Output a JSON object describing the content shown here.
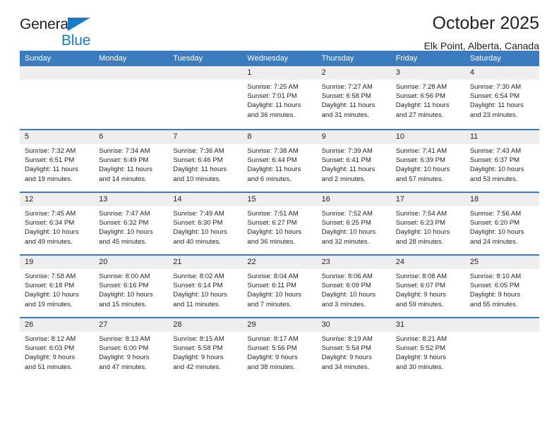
{
  "brand": {
    "name_top": "General",
    "name_bottom": "Blue",
    "triangle_icon": "blue-triangle-logo-icon",
    "accent_color": "#1a7ac4"
  },
  "header": {
    "title": "October 2025",
    "subtitle": "Elk Point, Alberta, Canada"
  },
  "theme": {
    "header_blue": "#3b7cbe",
    "day_band_gray": "#eeeeee",
    "text_color": "#231f20"
  },
  "weekdays": [
    "Sunday",
    "Monday",
    "Tuesday",
    "Wednesday",
    "Thursday",
    "Friday",
    "Saturday"
  ],
  "labels": {
    "sunrise": "Sunrise:",
    "sunset": "Sunset:",
    "daylight": "Daylight:"
  },
  "weeks": [
    [
      {
        "day": "",
        "empty": true
      },
      {
        "day": "",
        "empty": true
      },
      {
        "day": "",
        "empty": true
      },
      {
        "day": "1",
        "sunrise": "Sunrise: 7:25 AM",
        "sunset": "Sunset: 7:01 PM",
        "daylight": "Daylight: 11 hours and 36 minutes."
      },
      {
        "day": "2",
        "sunrise": "Sunrise: 7:27 AM",
        "sunset": "Sunset: 6:58 PM",
        "daylight": "Daylight: 11 hours and 31 minutes."
      },
      {
        "day": "3",
        "sunrise": "Sunrise: 7:28 AM",
        "sunset": "Sunset: 6:56 PM",
        "daylight": "Daylight: 11 hours and 27 minutes."
      },
      {
        "day": "4",
        "sunrise": "Sunrise: 7:30 AM",
        "sunset": "Sunset: 6:54 PM",
        "daylight": "Daylight: 11 hours and 23 minutes."
      }
    ],
    [
      {
        "day": "5",
        "sunrise": "Sunrise: 7:32 AM",
        "sunset": "Sunset: 6:51 PM",
        "daylight": "Daylight: 11 hours and 19 minutes."
      },
      {
        "day": "6",
        "sunrise": "Sunrise: 7:34 AM",
        "sunset": "Sunset: 6:49 PM",
        "daylight": "Daylight: 11 hours and 14 minutes."
      },
      {
        "day": "7",
        "sunrise": "Sunrise: 7:36 AM",
        "sunset": "Sunset: 6:46 PM",
        "daylight": "Daylight: 11 hours and 10 minutes."
      },
      {
        "day": "8",
        "sunrise": "Sunrise: 7:38 AM",
        "sunset": "Sunset: 6:44 PM",
        "daylight": "Daylight: 11 hours and 6 minutes."
      },
      {
        "day": "9",
        "sunrise": "Sunrise: 7:39 AM",
        "sunset": "Sunset: 6:41 PM",
        "daylight": "Daylight: 11 hours and 2 minutes."
      },
      {
        "day": "10",
        "sunrise": "Sunrise: 7:41 AM",
        "sunset": "Sunset: 6:39 PM",
        "daylight": "Daylight: 10 hours and 57 minutes."
      },
      {
        "day": "11",
        "sunrise": "Sunrise: 7:43 AM",
        "sunset": "Sunset: 6:37 PM",
        "daylight": "Daylight: 10 hours and 53 minutes."
      }
    ],
    [
      {
        "day": "12",
        "sunrise": "Sunrise: 7:45 AM",
        "sunset": "Sunset: 6:34 PM",
        "daylight": "Daylight: 10 hours and 49 minutes."
      },
      {
        "day": "13",
        "sunrise": "Sunrise: 7:47 AM",
        "sunset": "Sunset: 6:32 PM",
        "daylight": "Daylight: 10 hours and 45 minutes."
      },
      {
        "day": "14",
        "sunrise": "Sunrise: 7:49 AM",
        "sunset": "Sunset: 6:30 PM",
        "daylight": "Daylight: 10 hours and 40 minutes."
      },
      {
        "day": "15",
        "sunrise": "Sunrise: 7:51 AM",
        "sunset": "Sunset: 6:27 PM",
        "daylight": "Daylight: 10 hours and 36 minutes."
      },
      {
        "day": "16",
        "sunrise": "Sunrise: 7:52 AM",
        "sunset": "Sunset: 6:25 PM",
        "daylight": "Daylight: 10 hours and 32 minutes."
      },
      {
        "day": "17",
        "sunrise": "Sunrise: 7:54 AM",
        "sunset": "Sunset: 6:23 PM",
        "daylight": "Daylight: 10 hours and 28 minutes."
      },
      {
        "day": "18",
        "sunrise": "Sunrise: 7:56 AM",
        "sunset": "Sunset: 6:20 PM",
        "daylight": "Daylight: 10 hours and 24 minutes."
      }
    ],
    [
      {
        "day": "19",
        "sunrise": "Sunrise: 7:58 AM",
        "sunset": "Sunset: 6:18 PM",
        "daylight": "Daylight: 10 hours and 19 minutes."
      },
      {
        "day": "20",
        "sunrise": "Sunrise: 8:00 AM",
        "sunset": "Sunset: 6:16 PM",
        "daylight": "Daylight: 10 hours and 15 minutes."
      },
      {
        "day": "21",
        "sunrise": "Sunrise: 8:02 AM",
        "sunset": "Sunset: 6:14 PM",
        "daylight": "Daylight: 10 hours and 11 minutes."
      },
      {
        "day": "22",
        "sunrise": "Sunrise: 8:04 AM",
        "sunset": "Sunset: 6:11 PM",
        "daylight": "Daylight: 10 hours and 7 minutes."
      },
      {
        "day": "23",
        "sunrise": "Sunrise: 8:06 AM",
        "sunset": "Sunset: 6:09 PM",
        "daylight": "Daylight: 10 hours and 3 minutes."
      },
      {
        "day": "24",
        "sunrise": "Sunrise: 8:08 AM",
        "sunset": "Sunset: 6:07 PM",
        "daylight": "Daylight: 9 hours and 59 minutes."
      },
      {
        "day": "25",
        "sunrise": "Sunrise: 8:10 AM",
        "sunset": "Sunset: 6:05 PM",
        "daylight": "Daylight: 9 hours and 55 minutes."
      }
    ],
    [
      {
        "day": "26",
        "sunrise": "Sunrise: 8:12 AM",
        "sunset": "Sunset: 6:03 PM",
        "daylight": "Daylight: 9 hours and 51 minutes."
      },
      {
        "day": "27",
        "sunrise": "Sunrise: 8:13 AM",
        "sunset": "Sunset: 6:00 PM",
        "daylight": "Daylight: 9 hours and 47 minutes."
      },
      {
        "day": "28",
        "sunrise": "Sunrise: 8:15 AM",
        "sunset": "Sunset: 5:58 PM",
        "daylight": "Daylight: 9 hours and 42 minutes."
      },
      {
        "day": "29",
        "sunrise": "Sunrise: 8:17 AM",
        "sunset": "Sunset: 5:56 PM",
        "daylight": "Daylight: 9 hours and 38 minutes."
      },
      {
        "day": "30",
        "sunrise": "Sunrise: 8:19 AM",
        "sunset": "Sunset: 5:54 PM",
        "daylight": "Daylight: 9 hours and 34 minutes."
      },
      {
        "day": "31",
        "sunrise": "Sunrise: 8:21 AM",
        "sunset": "Sunset: 5:52 PM",
        "daylight": "Daylight: 9 hours and 30 minutes."
      },
      {
        "day": "",
        "empty": true
      }
    ]
  ]
}
